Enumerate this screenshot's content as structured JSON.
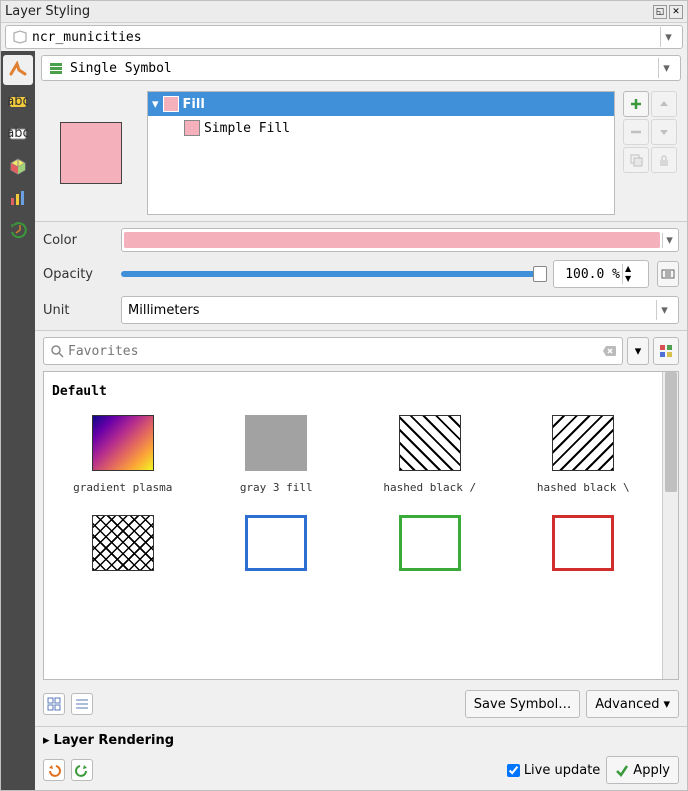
{
  "title": "Layer Styling",
  "layer_name": "ncr_municities",
  "renderer": "Single Symbol",
  "tree": {
    "root": "Fill",
    "child": "Simple Fill"
  },
  "props": {
    "color_label": "Color",
    "opacity_label": "Opacity",
    "opacity_value": "100.0 %",
    "unit_label": "Unit",
    "unit_value": "Millimeters"
  },
  "search_placeholder": "Favorites",
  "gallery_title": "Default",
  "swatches": [
    {
      "label": "gradient plasma"
    },
    {
      "label": "gray 3 fill"
    },
    {
      "label": "hashed black /"
    },
    {
      "label": "hashed black \\"
    },
    {
      "label": ""
    },
    {
      "label": ""
    },
    {
      "label": ""
    },
    {
      "label": ""
    }
  ],
  "buttons": {
    "save_symbol": "Save Symbol…",
    "advanced": "Advanced"
  },
  "footer": {
    "section": "Layer Rendering",
    "live_update": "Live update",
    "apply": "Apply"
  },
  "colors": {
    "fill": "#f4b0bb",
    "accent": "#3f8fd9"
  }
}
